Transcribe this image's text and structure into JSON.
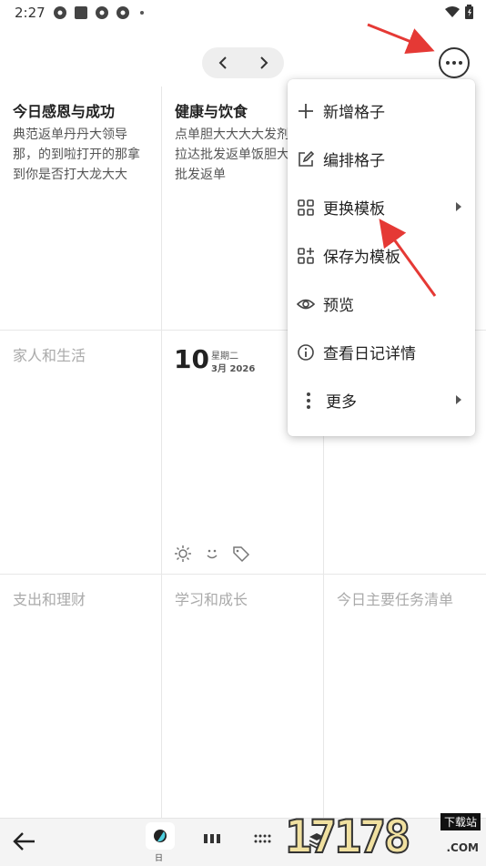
{
  "status_bar": {
    "time": "2:27"
  },
  "grid": {
    "cells": [
      {
        "title": "今日感恩与成功",
        "body": "典范返单丹丹大领导那，的到啦打开的那拿到你是否打大龙大大"
      },
      {
        "title": "健康与饮食",
        "body": "点单胆大大大大发剂飞拉达批发返单饭胆大打批发返单"
      },
      {
        "title": "家人和生活",
        "body": ""
      },
      {
        "title": "支出和理财",
        "body": ""
      },
      {
        "title": "学习和成长",
        "body": ""
      },
      {
        "title": "今日主要任务清单",
        "body": ""
      }
    ],
    "date": {
      "day": "10",
      "weekday": "星期二",
      "month_year": "3月 2026"
    }
  },
  "menu": {
    "items": [
      {
        "label": "新增格子",
        "icon": "plus-icon"
      },
      {
        "label": "编排格子",
        "icon": "edit-icon"
      },
      {
        "label": "更换模板",
        "icon": "grid-icon"
      },
      {
        "label": "保存为模板",
        "icon": "grid-add-icon"
      },
      {
        "label": "预览",
        "icon": "eye-icon"
      },
      {
        "label": "查看日记详情",
        "icon": "info-icon"
      },
      {
        "label": "更多",
        "icon": "more-vert-icon"
      }
    ]
  },
  "bottom_bar": {
    "selected_label": "日"
  },
  "watermark": {
    "text": "17178",
    "tag": "下载站",
    "domain": ".COM"
  },
  "colors": {
    "annotation_arrow": "#e53935",
    "divider": "#e7e7e7"
  }
}
